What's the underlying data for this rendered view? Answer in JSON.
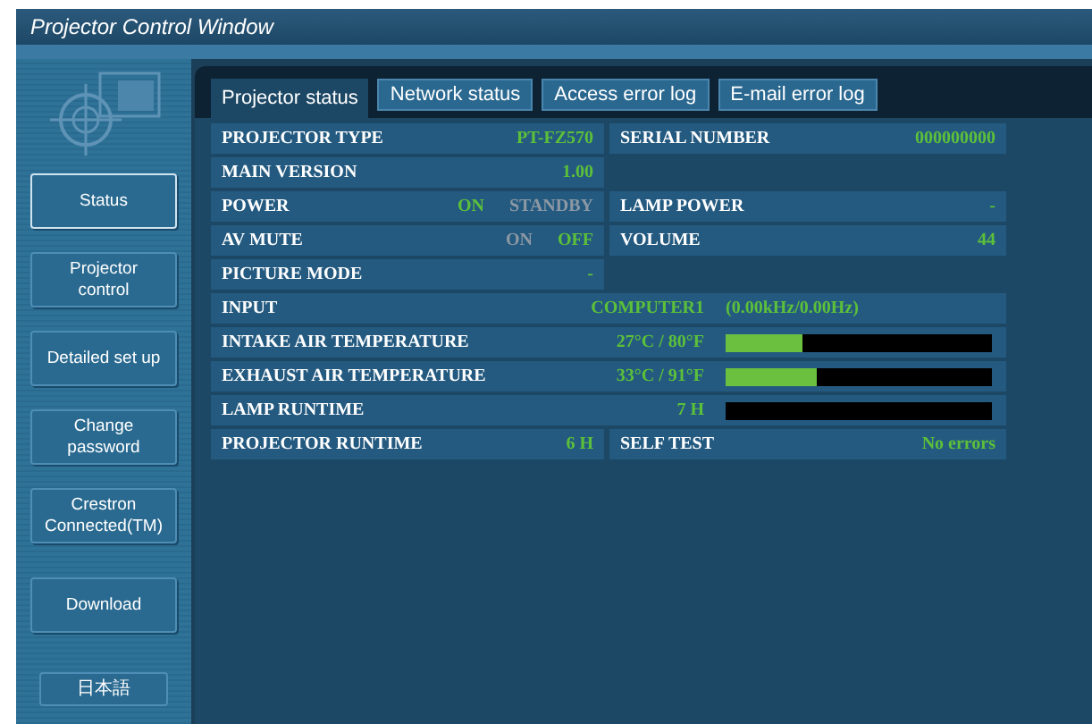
{
  "window": {
    "title": "Projector Control Window"
  },
  "sidebar": {
    "items": [
      {
        "label": "Status",
        "selected": true
      },
      {
        "label": "Projector control",
        "selected": false
      },
      {
        "label": "Detailed set up",
        "selected": false
      },
      {
        "label": "Change password",
        "selected": false
      },
      {
        "label": "Crestron Connected(TM)",
        "selected": false
      },
      {
        "label": "Download",
        "selected": false
      }
    ],
    "language_button": "日本語"
  },
  "tabs": [
    {
      "label": "Projector status",
      "selected": true
    },
    {
      "label": "Network status",
      "selected": false
    },
    {
      "label": "Access error log",
      "selected": false
    },
    {
      "label": "E-mail error log",
      "selected": false
    }
  ],
  "rows": [
    {
      "kind": "pair",
      "cells": [
        {
          "label": "PROJECTOR TYPE",
          "values": [
            {
              "text": "PT-FZ570",
              "active": true
            }
          ]
        },
        {
          "label": "SERIAL NUMBER",
          "values": [
            {
              "text": "000000000",
              "active": true
            }
          ]
        }
      ]
    },
    {
      "kind": "pair",
      "cells": [
        {
          "label": "MAIN VERSION",
          "values": [
            {
              "text": "1.00",
              "active": true
            }
          ]
        }
      ]
    },
    {
      "kind": "pair",
      "cells": [
        {
          "label": "POWER",
          "values": [
            {
              "text": "ON",
              "active": true
            },
            {
              "text": "STANDBY",
              "active": false
            }
          ]
        },
        {
          "label": "LAMP POWER",
          "values": [
            {
              "text": "-",
              "active": true
            }
          ]
        }
      ]
    },
    {
      "kind": "pair",
      "cells": [
        {
          "label": "AV MUTE",
          "values": [
            {
              "text": "ON",
              "active": false
            },
            {
              "text": "OFF",
              "active": true
            }
          ]
        },
        {
          "label": "VOLUME",
          "values": [
            {
              "text": "44",
              "active": true
            }
          ]
        }
      ]
    },
    {
      "kind": "pair",
      "cells": [
        {
          "label": "PICTURE MODE",
          "values": [
            {
              "text": "-",
              "active": true
            }
          ]
        }
      ]
    },
    {
      "kind": "wide",
      "label": "INPUT",
      "value": "COMPUTER1",
      "detail": "(0.00kHz/0.00Hz)"
    },
    {
      "kind": "meter",
      "label": "INTAKE AIR TEMPERATURE",
      "value": "27°C / 80°F",
      "level": 0.29
    },
    {
      "kind": "meter",
      "label": "EXHAUST AIR TEMPERATURE",
      "value": "33°C / 91°F",
      "level": 0.34
    },
    {
      "kind": "meter",
      "label": "LAMP RUNTIME",
      "value": "7 H"
    },
    {
      "kind": "pair",
      "cells": [
        {
          "label": "PROJECTOR RUNTIME",
          "values": [
            {
              "text": "6 H",
              "active": true
            }
          ]
        },
        {
          "label": "SELF TEST",
          "values": [
            {
              "text": "No errors",
              "active": true
            }
          ]
        }
      ]
    }
  ]
}
